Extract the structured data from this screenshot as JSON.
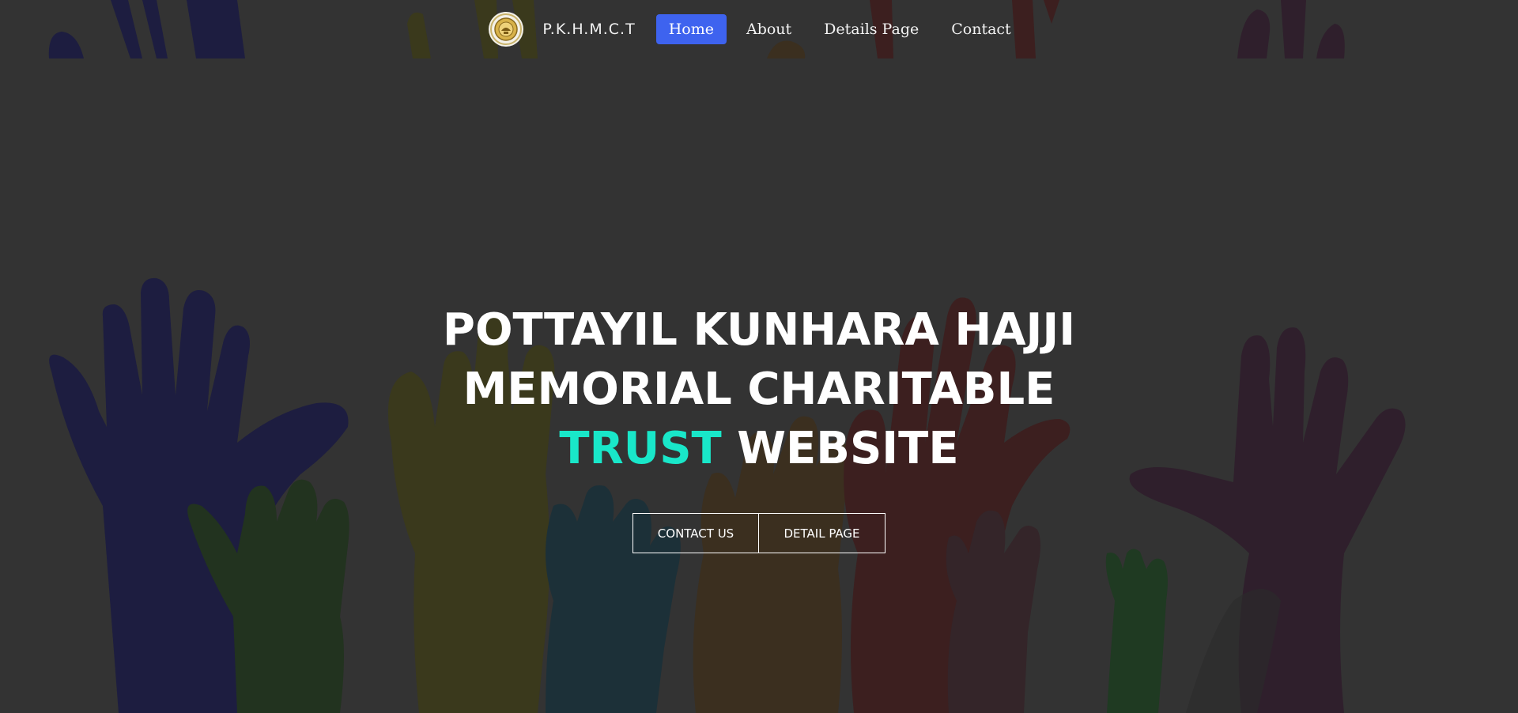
{
  "nav": {
    "brand": "P.K.H.M.C.T",
    "links": [
      {
        "label": "Home",
        "active": true
      },
      {
        "label": "About",
        "active": false
      },
      {
        "label": "Details Page",
        "active": false
      },
      {
        "label": "Contact",
        "active": false
      }
    ]
  },
  "hero": {
    "title_line1": "POTTAYIL KUNHARA HAJJI",
    "title_line2": "MEMORIAL CHARITABLE",
    "title_accent": "TRUST",
    "title_rest": "WEBSITE",
    "buttons": {
      "contact": "CONTACT US",
      "detail": "DETAIL PAGE"
    }
  },
  "colors": {
    "background": "#333333",
    "nav_active": "#3e63ef",
    "accent": "#19e7c9",
    "hand_colors": [
      "#1d1d40",
      "#22331f",
      "#3d3b1c",
      "#1c3038",
      "#3b2f1f",
      "#3c1f1f",
      "#2f1f2c",
      "#1f3a22"
    ]
  },
  "icons": {
    "logo": "seal-logo-icon",
    "background": "raised-hands-illustration"
  }
}
